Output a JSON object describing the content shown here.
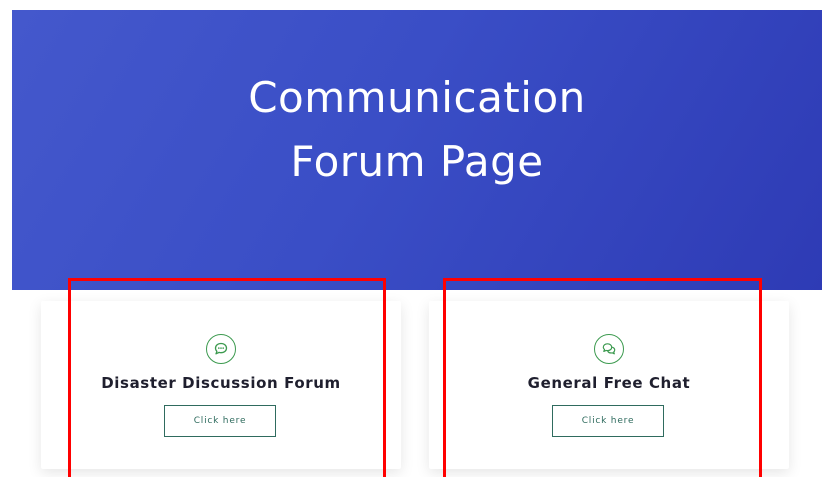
{
  "hero": {
    "title_line1": "Communication",
    "title_line2": "Forum Page",
    "background": "#3a4ec6"
  },
  "cards": [
    {
      "icon": "chat-bubble-icon",
      "title": "Disaster Discussion Forum",
      "button_label": "Click here"
    },
    {
      "icon": "two-chat-bubbles-icon",
      "title": "General Free Chat",
      "button_label": "Click here"
    }
  ],
  "colors": {
    "accent_icon": "#3c9a4f",
    "button_border": "#2f6b5e",
    "highlight": "#ff0000"
  }
}
